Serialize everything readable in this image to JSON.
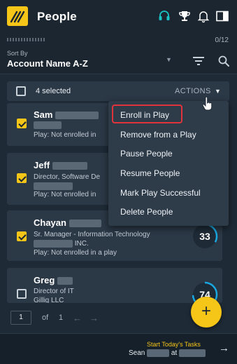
{
  "header": {
    "title": "People",
    "icons": [
      "headset-icon",
      "trophy-icon",
      "bell-icon",
      "panel-toggle-icon"
    ],
    "accent": "#19c3c3",
    "brand_color": "#f5c518"
  },
  "progress": {
    "count_text": "0/12",
    "value": 0
  },
  "sort": {
    "label": "Sort By",
    "value": "Account Name A-Z"
  },
  "selection": {
    "count_text": "4 selected",
    "actions_label": "ACTIONS"
  },
  "people": [
    {
      "name": "Sam",
      "title": "",
      "company": "",
      "status": "Play: Not enrolled in",
      "checked": true
    },
    {
      "name": "Jeff",
      "title": "Director, Software De",
      "company": "",
      "status": "Play: Not enrolled in",
      "checked": true
    },
    {
      "name": "Chayan",
      "title": "Sr. Manager - Information Technology",
      "company": "INC.",
      "status": "Play: Not enrolled in a play",
      "checked": true,
      "score": "33",
      "score_fraction": 0.33
    },
    {
      "name": "Greg",
      "title": "Director of IT",
      "company": "Gillig LLC",
      "status": "",
      "checked": false,
      "score": "74",
      "score_fraction": 0.74
    }
  ],
  "menu": {
    "items": [
      "Enroll in Play",
      "Remove from a Play",
      "Pause People",
      "Resume People",
      "Mark Play Successful",
      "Delete People"
    ],
    "highlighted": "Enroll in Play"
  },
  "pagination": {
    "current": "1",
    "of_label": "of",
    "total": "1"
  },
  "footer": {
    "tasks_label": "Start Today's Tasks",
    "user": "Sean",
    "at_label": "at"
  }
}
